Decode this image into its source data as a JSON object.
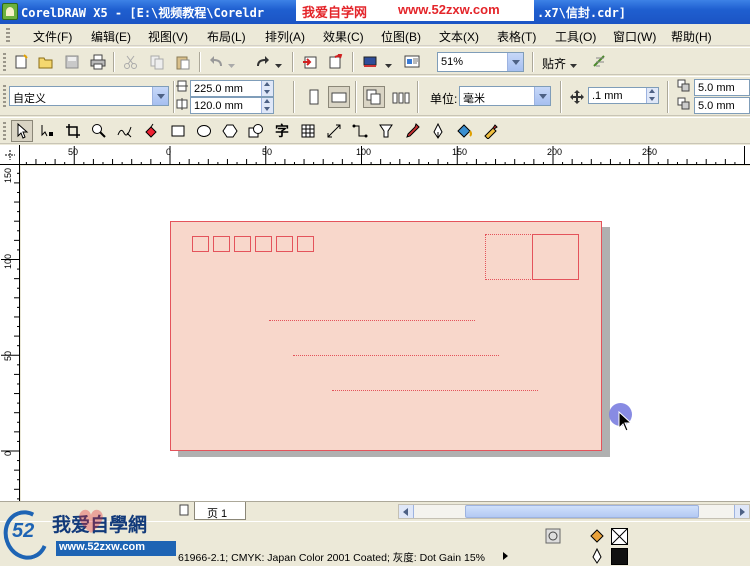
{
  "window": {
    "title_left": "CorelDRAW X5 - [E:\\视频教程\\Coreldr",
    "title_right": ".x7\\信封.cdr]"
  },
  "watermark": {
    "site_name": "我爱自学网",
    "site_url": "www.52zxw.com"
  },
  "menu": [
    {
      "label": "文件(F)"
    },
    {
      "label": "编辑(E)"
    },
    {
      "label": "视图(V)"
    },
    {
      "label": "布局(L)"
    },
    {
      "label": "排列(A)"
    },
    {
      "label": "效果(C)"
    },
    {
      "label": "位图(B)"
    },
    {
      "label": "文本(X)"
    },
    {
      "label": "表格(T)"
    },
    {
      "label": "工具(O)"
    },
    {
      "label": "窗口(W)"
    },
    {
      "label": "帮助(H)"
    }
  ],
  "standard_toolbar": {
    "zoom_level": "51%",
    "snap_label": "贴齐"
  },
  "property_bar": {
    "page_size_preset": "自定义",
    "width": "225.0 mm",
    "height": "120.0 mm",
    "units_label": "单位:",
    "units_value": "毫米",
    "nudge_distance": ".1 mm",
    "duplicate_x": "5.0 mm",
    "duplicate_y": "5.0 mm"
  },
  "toolbox": {
    "text_tool_glyph": "字"
  },
  "rulers": {
    "top_labels": [
      "50",
      "0",
      "50",
      "100",
      "150",
      "200",
      "250"
    ],
    "left_labels": [
      "150",
      "100",
      "50",
      "0"
    ],
    "unit": "毫米"
  },
  "document": {
    "envelope_fill": "#f8d7cb",
    "envelope_stroke": "#e4535b",
    "zip_box_count": 6
  },
  "page_tabs": [
    {
      "label": "页 1"
    }
  ],
  "status": {
    "color_profile_text": "61966-2.1; CMYK: Japan Color 2001 Coated; 灰度: Dot Gain 15%"
  },
  "logo": {
    "brand_cn": "我爱自學網",
    "brand_url": "www.52zxw.com",
    "brand_num": "52"
  },
  "colors": {
    "titlebar": "#1f5fd0",
    "accent_red": "#e4252a",
    "brand_blue": "#1e64b4"
  }
}
